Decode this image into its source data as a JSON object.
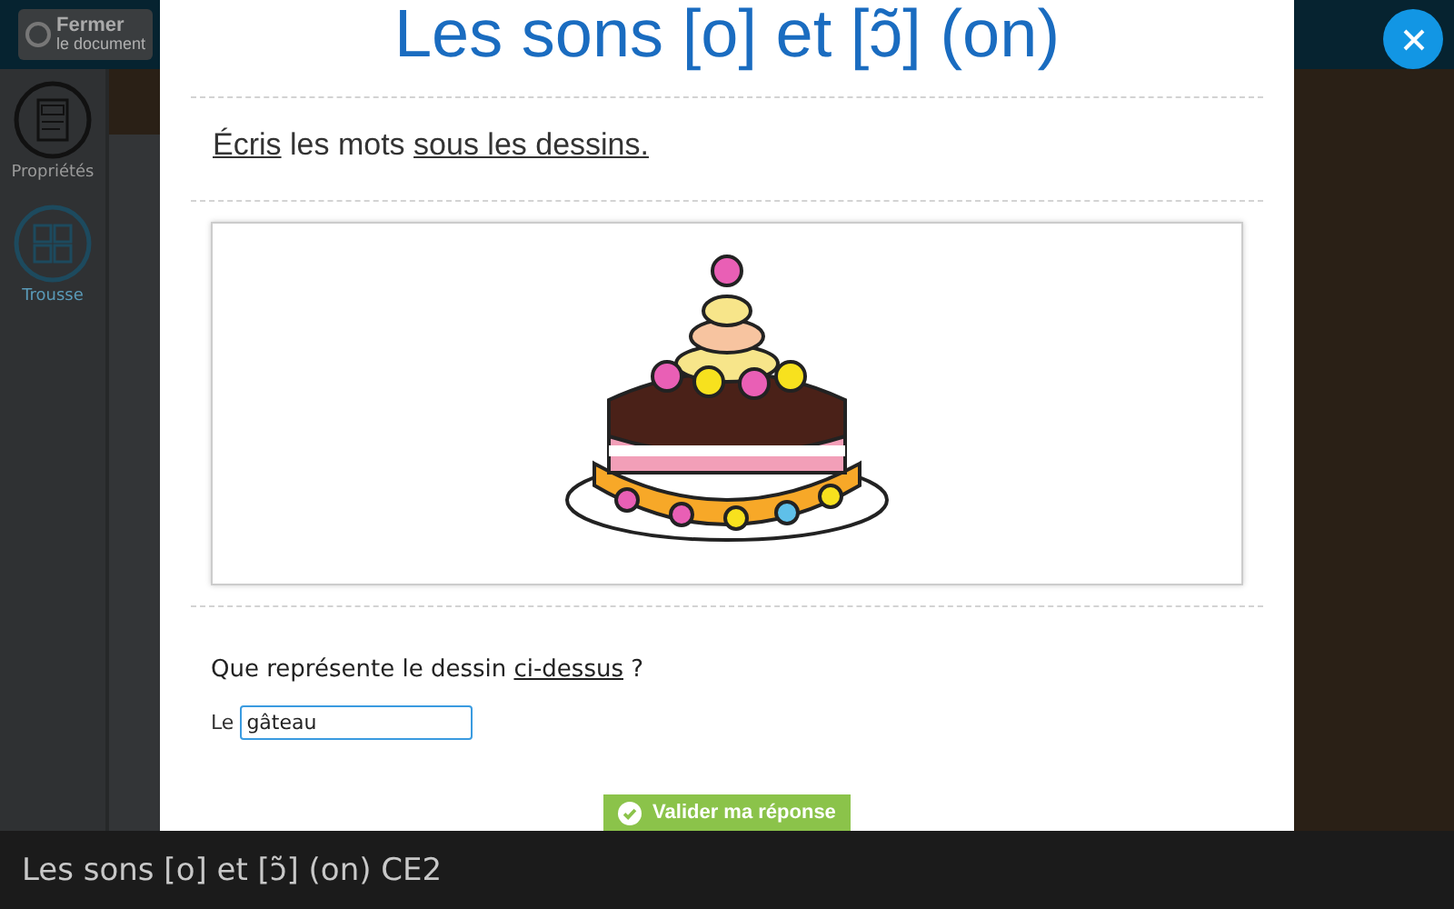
{
  "topbar": {
    "close_document": {
      "title": "Fermer",
      "subtitle": "le document"
    }
  },
  "sidebar": {
    "items": [
      {
        "label": "Propriétés",
        "kind": "document"
      },
      {
        "label": "Trousse",
        "kind": "kit"
      }
    ]
  },
  "modal": {
    "title": "Les sons [o] et [ɔ̃] (on)",
    "instruction": [
      {
        "text": "Écris",
        "underlined": true
      },
      {
        "text": " les mots ",
        "underlined": false
      },
      {
        "text": "sous les dessins.",
        "underlined": true
      }
    ],
    "question": [
      {
        "text": "Que représente le dessin ",
        "underlined": false
      },
      {
        "text": "ci-dessus",
        "underlined": true
      },
      {
        "text": " ?",
        "underlined": false
      }
    ],
    "answer": {
      "prefix": "Le",
      "value": "gâteau"
    },
    "submit_button": "Valider ma réponse"
  },
  "footer": {
    "title": "Les sons [o] et [ɔ̃] (on) CE2"
  }
}
